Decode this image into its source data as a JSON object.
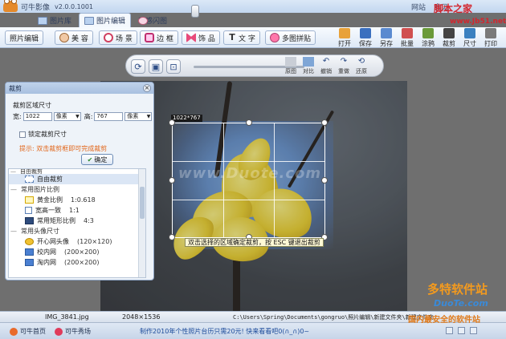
{
  "app": {
    "title": "可牛影像",
    "version": "v2.0.0.1001"
  },
  "title_links": [
    "网站",
    "意见"
  ],
  "main_tabs": [
    {
      "label": "图片库",
      "active": false
    },
    {
      "label": "图片编辑",
      "active": true
    },
    {
      "label": "动感闪图",
      "active": false
    }
  ],
  "toolbar": {
    "left": [
      {
        "label": "照片编辑",
        "icon": "photo-icon"
      },
      {
        "label": "美 容",
        "icon": "face-icon"
      },
      {
        "label": "场 景",
        "icon": "scene-icon"
      },
      {
        "label": "边 框",
        "icon": "border-icon"
      },
      {
        "label": "饰 品",
        "icon": "bow-icon"
      },
      {
        "label": "文 字",
        "icon": "text-icon"
      },
      {
        "label": "多图拼贴",
        "icon": "collage-icon"
      }
    ],
    "right": [
      {
        "label": "打开",
        "icon": "open-icon",
        "color": "#e8a23a"
      },
      {
        "label": "保存",
        "icon": "save-icon",
        "color": "#3a6fbf"
      },
      {
        "label": "另存",
        "icon": "save-as-icon",
        "color": "#5a8ad0"
      },
      {
        "label": "批量",
        "icon": "batch-icon",
        "color": "#d05050"
      },
      {
        "label": "涂鸦",
        "icon": "brush-icon",
        "color": "#6a9a3a"
      },
      {
        "label": "裁剪",
        "icon": "crop-icon",
        "color": "#444444"
      },
      {
        "label": "尺寸",
        "icon": "resize-icon",
        "color": "#3a80c0"
      },
      {
        "label": "打印",
        "icon": "print-icon",
        "color": "#7a7a7a"
      }
    ]
  },
  "viewbar": {
    "tools": [
      {
        "label": "原图",
        "icon": "original-icon"
      },
      {
        "label": "对比",
        "icon": "compare-icon"
      },
      {
        "label": "撤销",
        "icon": "undo-icon"
      },
      {
        "label": "重做",
        "icon": "redo-icon"
      },
      {
        "label": "还原",
        "icon": "restore-icon"
      }
    ],
    "zoom": 0
  },
  "crop_panel": {
    "title": "裁剪",
    "size_title": "裁剪区域尺寸",
    "width_label": "宽:",
    "width_value": "1022",
    "width_unit": "像素",
    "height_label": "高:",
    "height_value": "767",
    "height_unit": "像素",
    "lock_label": "锁定裁剪尺寸",
    "hint": "提示: 双击裁剪框即可完成裁剪",
    "ok_label": "确定",
    "list_cut_header": "自由裁剪",
    "list": [
      {
        "type": "item",
        "label": "自由裁剪",
        "ratio": "",
        "icon": "free-crop-icon",
        "selected": true
      },
      {
        "type": "header",
        "label": "常用图片比例"
      },
      {
        "type": "item",
        "label": "黄金比例",
        "ratio": "1:0.618",
        "icon": "golden-ratio-icon"
      },
      {
        "type": "item",
        "label": "宽高一致",
        "ratio": "1:1",
        "icon": "square-icon"
      },
      {
        "type": "item",
        "label": "常用矩形比例",
        "ratio": "4:3",
        "icon": "screen-icon"
      },
      {
        "type": "header",
        "label": "常用头像尺寸"
      },
      {
        "type": "item",
        "label": "开心网头像",
        "ratio": "(120×120)",
        "icon": "kaixin-icon"
      },
      {
        "type": "item",
        "label": "校内网",
        "ratio": "(200×200)",
        "icon": "xiaonei-icon"
      },
      {
        "type": "item",
        "label": "淘内网",
        "ratio": "(200×200)",
        "icon": "taonei-icon"
      }
    ]
  },
  "canvas": {
    "crop_size_label": "1022*767",
    "crop_hint": "双击选择的区域确定裁剪，按 ESC 键退出裁剪",
    "watermark": "www.Duote.com"
  },
  "status": {
    "filename": "IMG_3841.jpg",
    "dimensions": "2048×1536",
    "path": "C:\\Users\\Spring\\Documents\\gongruo\\照片编辑\\新建文件夹\\新建文件夹"
  },
  "bottom": {
    "home_label": "可牛首页",
    "show_label": "可牛秀场",
    "promo": "制作2010年个性照片台历只需20元! 快来看看吧0(∩_∩)0~"
  },
  "overlay_brands": {
    "top_right": "脚本之家",
    "top_right_url": "www.Jb51.net",
    "bottom_brand": "多特软件站",
    "bottom_url": "DuoTe.com",
    "bottom_slogan": "国内最安全的软件站"
  }
}
